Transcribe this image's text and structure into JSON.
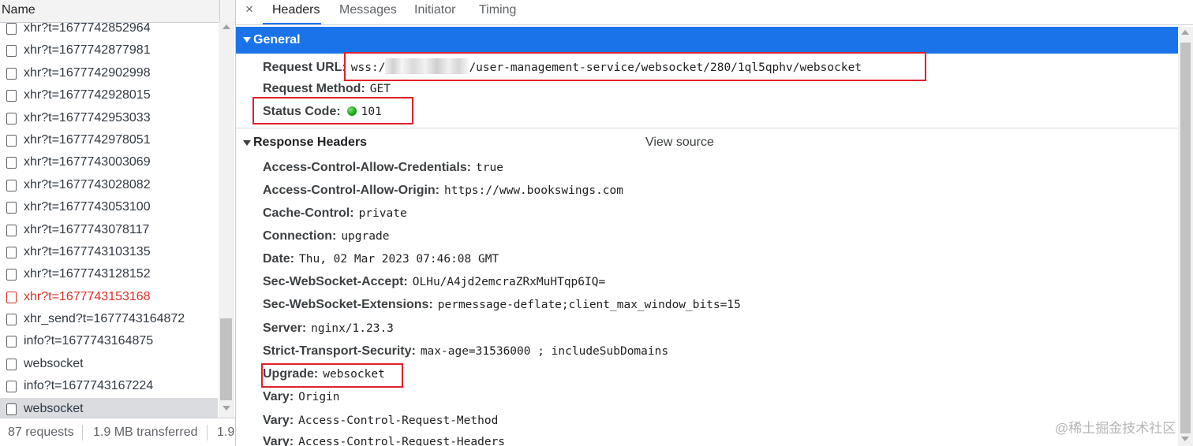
{
  "left_panel": {
    "header": {
      "name_col": "Name"
    },
    "requests": [
      {
        "label": "xhr?t=1677742852964",
        "state": "normal"
      },
      {
        "label": "xhr?t=1677742877981",
        "state": "normal"
      },
      {
        "label": "xhr?t=1677742902998",
        "state": "normal"
      },
      {
        "label": "xhr?t=1677742928015",
        "state": "normal"
      },
      {
        "label": "xhr?t=1677742953033",
        "state": "normal"
      },
      {
        "label": "xhr?t=1677742978051",
        "state": "normal"
      },
      {
        "label": "xhr?t=1677743003069",
        "state": "normal"
      },
      {
        "label": "xhr?t=1677743028082",
        "state": "normal"
      },
      {
        "label": "xhr?t=1677743053100",
        "state": "normal"
      },
      {
        "label": "xhr?t=1677743078117",
        "state": "normal"
      },
      {
        "label": "xhr?t=1677743103135",
        "state": "normal"
      },
      {
        "label": "xhr?t=1677743128152",
        "state": "normal"
      },
      {
        "label": "xhr?t=1677743153168",
        "state": "error"
      },
      {
        "label": "xhr_send?t=1677743164872",
        "state": "normal"
      },
      {
        "label": "info?t=1677743164875",
        "state": "normal"
      },
      {
        "label": "websocket",
        "state": "normal"
      },
      {
        "label": "info?t=1677743167224",
        "state": "normal"
      },
      {
        "label": "websocket",
        "state": "selected"
      }
    ],
    "status_bar": {
      "requests": "87 requests",
      "transferred": "1.9 MB transferred",
      "resources": "1.9"
    }
  },
  "tabs": {
    "close": "×",
    "items": [
      "Headers",
      "Messages",
      "Initiator",
      "Timing"
    ],
    "active": "Headers"
  },
  "general": {
    "title": "General",
    "request_url": {
      "key": "Request URL:",
      "prefix": "wss:/",
      "path": "/user-management-service/websocket/280/1ql5qphv/websocket"
    },
    "request_method": {
      "key": "Request Method:",
      "value": "GET"
    },
    "status_code": {
      "key": "Status Code:",
      "value": "101"
    }
  },
  "response_headers": {
    "title": "Response Headers",
    "view_source": "View source",
    "items": [
      {
        "key": "Access-Control-Allow-Credentials:",
        "value": "true"
      },
      {
        "key": "Access-Control-Allow-Origin:",
        "value": "https://www.bookswings.com"
      },
      {
        "key": "Cache-Control:",
        "value": "private"
      },
      {
        "key": "Connection:",
        "value": "upgrade"
      },
      {
        "key": "Date:",
        "value": "Thu, 02 Mar 2023 07:46:08 GMT"
      },
      {
        "key": "Sec-WebSocket-Accept:",
        "value": "OLHu/A4jd2emcraZRxMuHTqp6IQ="
      },
      {
        "key": "Sec-WebSocket-Extensions:",
        "value": "permessage-deflate;client_max_window_bits=15"
      },
      {
        "key": "Server:",
        "value": "nginx/1.23.3"
      },
      {
        "key": "Strict-Transport-Security:",
        "value": "max-age=31536000 ; includeSubDomains"
      },
      {
        "key": "Upgrade:",
        "value": "websocket"
      },
      {
        "key": "Vary:",
        "value": "Origin"
      },
      {
        "key": "Vary:",
        "value": "Access-Control-Request-Method"
      },
      {
        "key": "Vary:",
        "value": "Access-Control-Request-Headers"
      }
    ]
  },
  "watermark": "@稀土掘金技术社区",
  "colors": {
    "accent": "#1a73e8",
    "highlight_box": "#e0202a",
    "error_text": "#d93025",
    "status_ok": "#19a319"
  }
}
